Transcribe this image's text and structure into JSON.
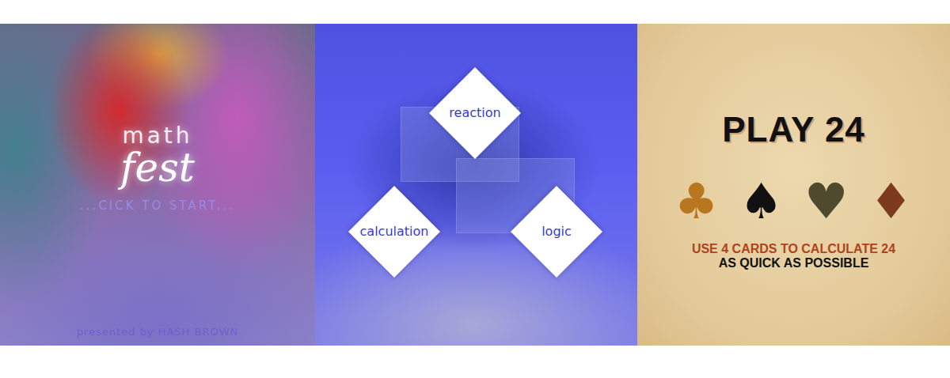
{
  "intro": {
    "title_small": "math",
    "title_large": "fest",
    "prompt": "...CICK TO START...",
    "credit": "presented by HASH BROWN"
  },
  "menu": {
    "options": [
      {
        "label": "reaction"
      },
      {
        "label": "calculation"
      },
      {
        "label": "logic"
      }
    ]
  },
  "play24": {
    "title": "PLAY 24",
    "suits": [
      {
        "symbol": "♣",
        "color": "#b8771f"
      },
      {
        "symbol": "♠",
        "color": "#111111"
      },
      {
        "symbol": "♥",
        "color": "#4f4a2e"
      },
      {
        "symbol": "♦",
        "color": "#7d3a1f"
      }
    ],
    "instructions": [
      {
        "text": "USE 4 CARDS TO CALCULATE 24",
        "color": "#b0431c"
      },
      {
        "text": "AS QUICK AS POSSIBLE",
        "color": "#111111"
      }
    ]
  }
}
